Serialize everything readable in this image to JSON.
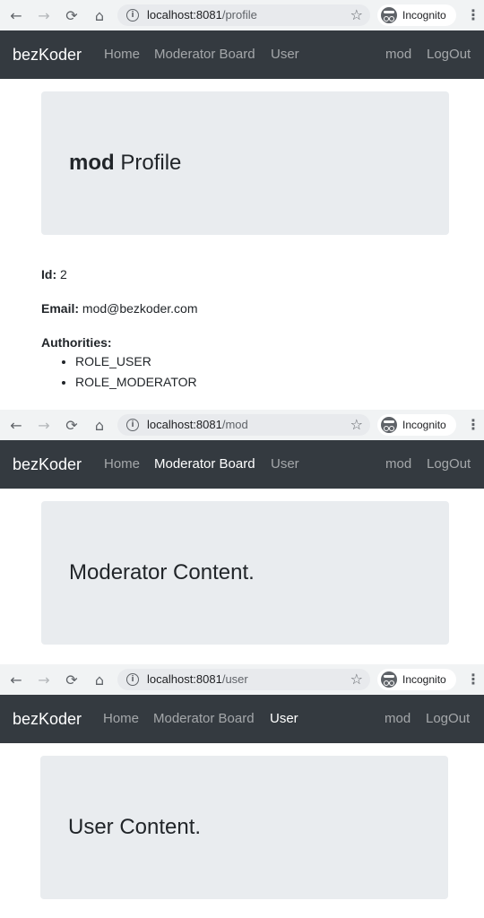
{
  "screens": [
    {
      "url_host": "localhost:8081",
      "url_path": "/profile",
      "incognito_label": "Incognito",
      "brand": "bezKoder",
      "nav": {
        "home": "Home",
        "moderator_board": "Moderator Board",
        "user": "User",
        "username": "mod",
        "logout": "LogOut"
      },
      "jumbotron": {
        "bold": "mod",
        "rest": " Profile"
      },
      "profile": {
        "id_label": "Id:",
        "id_value": " 2",
        "email_label": "Email:",
        "email_value": " mod@bezkoder.com",
        "authorities_label": "Authorities:",
        "authorities": [
          "ROLE_USER",
          "ROLE_MODERATOR"
        ]
      }
    },
    {
      "url_host": "localhost:8081",
      "url_path": "/mod",
      "incognito_label": "Incognito",
      "brand": "bezKoder",
      "nav": {
        "home": "Home",
        "moderator_board": "Moderator Board",
        "user": "User",
        "username": "mod",
        "logout": "LogOut"
      },
      "jumbotron": {
        "text": "Moderator Content."
      }
    },
    {
      "url_host": "localhost:8081",
      "url_path": "/user",
      "incognito_label": "Incognito",
      "brand": "bezKoder",
      "nav": {
        "home": "Home",
        "moderator_board": "Moderator Board",
        "user": "User",
        "username": "mod",
        "logout": "LogOut"
      },
      "jumbotron": {
        "text": "User Content."
      }
    }
  ],
  "icons": {
    "back": "←",
    "forward": "→",
    "reload": "⟳",
    "home": "⌂",
    "info": "i",
    "star": "☆",
    "menu": "⋮"
  },
  "colors": {
    "chrome_bg": "#f1f3f4",
    "omnibox_bg": "#e8eaed",
    "navbar_bg": "#343a40",
    "jumbotron_bg": "#e9ecef",
    "text": "#212529"
  }
}
